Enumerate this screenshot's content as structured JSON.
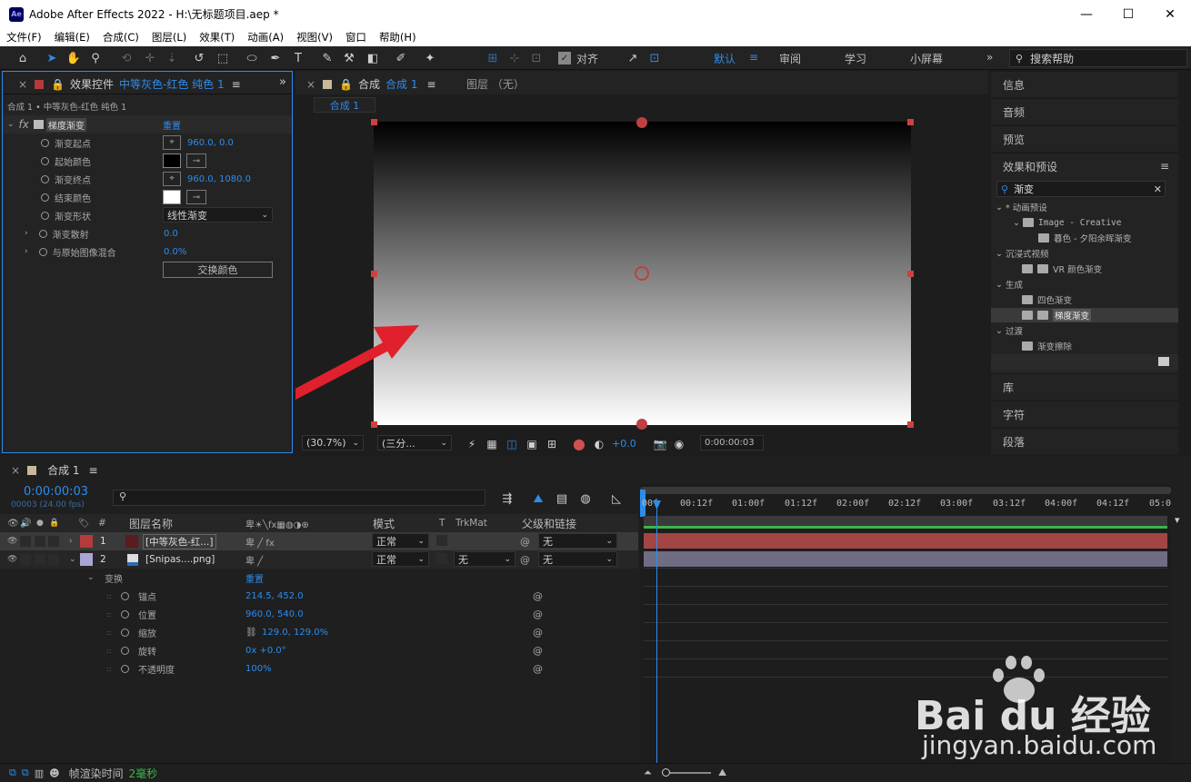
{
  "app": {
    "title": "Adobe After Effects 2022 - H:\\无标题项目.aep *",
    "logo": "Ae"
  },
  "menu": [
    "文件(F)",
    "编辑(E)",
    "合成(C)",
    "图层(L)",
    "效果(T)",
    "动画(A)",
    "视图(V)",
    "窗口",
    "帮助(H)"
  ],
  "toolbar": {
    "align_label": "对齐",
    "workspaces": [
      "默认",
      "审阅",
      "学习",
      "小屏幕"
    ],
    "search_placeholder": "搜索帮助"
  },
  "effects_panel": {
    "tab_label": "效果控件",
    "layer_name": "中等灰色-红色 纯色 1",
    "breadcrumb": "合成 1 • 中等灰色-红色 纯色 1",
    "effect_name": "梯度渐变",
    "reset": "重置",
    "params": [
      {
        "label": "渐变起点",
        "value": "960.0, 0.0"
      },
      {
        "label": "起始颜色",
        "value": ""
      },
      {
        "label": "渐变终点",
        "value": "960.0, 1080.0"
      },
      {
        "label": "结束颜色",
        "value": ""
      },
      {
        "label": "渐变形状",
        "value": "线性渐变"
      },
      {
        "label": "渐变散射",
        "value": "0.0"
      },
      {
        "label": "与原始图像混合",
        "value": "0.0%"
      }
    ],
    "swap_button": "交换颜色",
    "start_color": "#000000",
    "end_color": "#ffffff"
  },
  "comp_panel": {
    "tab_label": "合成",
    "comp_name": "合成 1",
    "layer_tab": "图层 （无）",
    "sub_tab": "合成 1",
    "zoom": "(30.7%)",
    "resolution": "(三分...",
    "exposure": "+0.0",
    "timecode": "0:00:00:03"
  },
  "right_panel": {
    "top_items": [
      "信息",
      "音频",
      "预览"
    ],
    "effects_presets": "效果和预设",
    "search_value": "渐变",
    "tree": [
      {
        "label": "* 动画预设",
        "level": 0
      },
      {
        "label": "Image - Creative",
        "level": 1
      },
      {
        "label": "暮色 - 夕阳余晖渐变",
        "level": 2
      },
      {
        "label": "沉浸式视频",
        "level": 0
      },
      {
        "label": "VR 颜色渐变",
        "level": 1
      },
      {
        "label": "生成",
        "level": 0
      },
      {
        "label": "四色渐变",
        "level": 1
      },
      {
        "label": "梯度渐变",
        "level": 1
      },
      {
        "label": "过渡",
        "level": 0
      },
      {
        "label": "渐变擦除",
        "level": 1
      }
    ],
    "bottom_items": [
      "库",
      "字符",
      "段落"
    ]
  },
  "timeline": {
    "tab_label": "合成 1",
    "timecode": "0:00:00:03",
    "frame_info": "00003 (24.00 fps)",
    "ruler": [
      "00f",
      "00:12f",
      "01:00f",
      "01:12f",
      "02:00f",
      "02:12f",
      "03:00f",
      "03:12f",
      "04:00f",
      "04:12f",
      "05:0"
    ],
    "headers": {
      "num": "#",
      "layer_name": "图层名称",
      "mode": "模式",
      "t": "T",
      "trkmat": "TrkMat",
      "parent": "父级和链接"
    },
    "layers": [
      {
        "num": "1",
        "name": "[中等灰色-红...]",
        "mode": "正常",
        "trkmat": "",
        "parent": "无",
        "color": "#b43b3b"
      },
      {
        "num": "2",
        "name": "[Snipas....png]",
        "mode": "正常",
        "trkmat": "无",
        "parent": "无",
        "color": "#a9a6d4"
      }
    ],
    "transform": {
      "label": "变换",
      "reset": "重置",
      "props": [
        {
          "label": "锚点",
          "value": "214.5, 452.0"
        },
        {
          "label": "位置",
          "value": "960.0, 540.0"
        },
        {
          "label": "缩放",
          "value": "129.0, 129.0%"
        },
        {
          "label": "旋转",
          "value": "0x +0.0°"
        },
        {
          "label": "不透明度",
          "value": "100%"
        }
      ]
    },
    "status": {
      "label": "帧渲染时间",
      "value": "2毫秒"
    }
  },
  "watermark": {
    "brand": "Bai du 经验",
    "url": "jingyan.baidu.com"
  }
}
